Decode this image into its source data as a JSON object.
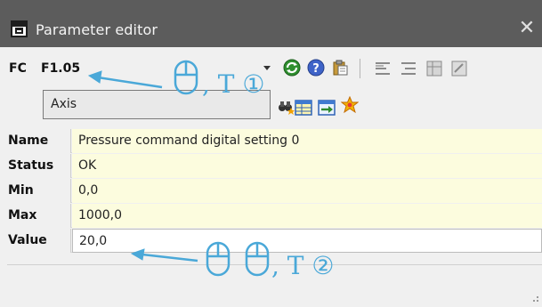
{
  "window": {
    "title": "Parameter editor",
    "close_glyph": "✕"
  },
  "toolbar": {
    "fc_label": "FC",
    "parameter_code": "F1.05",
    "dropdown_icon": "chevron-down-icon",
    "search_field_value": "Axis",
    "icons_row1": [
      "refresh-icon",
      "help-icon",
      "clipboard-icon",
      "align-left-icon",
      "align-left-alt-icon",
      "grid-icon",
      "edit-icon"
    ],
    "icons_row2": [
      "binoculars-star-icon",
      "table-icon",
      "export-icon",
      "star-burst-icon"
    ]
  },
  "table": {
    "rows": [
      {
        "key": "Name",
        "value": "Pressure command digital setting 0"
      },
      {
        "key": "Status",
        "value": "OK"
      },
      {
        "key": "Min",
        "value": "0,0"
      },
      {
        "key": "Max",
        "value": "1000,0"
      },
      {
        "key": "Value",
        "value": "20,0"
      }
    ]
  },
  "annotations": {
    "step1_text": ", T ①",
    "step2_text": ", T ②",
    "accent": "#4aa8d8"
  },
  "colors": {
    "titlebar": "#5c5c5c",
    "value_bg": "#fcfcde",
    "window_bg": "#f0f0f0"
  }
}
